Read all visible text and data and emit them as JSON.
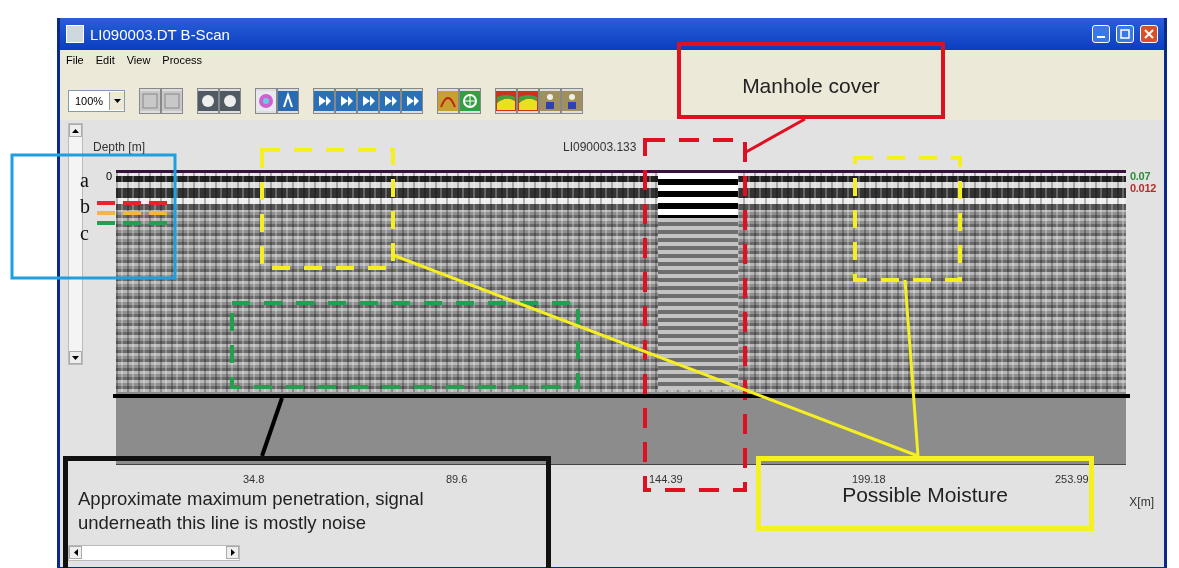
{
  "window": {
    "title": "LI090003.DT  B-Scan"
  },
  "menu": [
    "File",
    "Edit",
    "View",
    "Process"
  ],
  "toolbar": {
    "zoom": "100%"
  },
  "scan": {
    "depth_label": "Depth [m]",
    "depth_zero": "0",
    "file_label": "LI090003.133",
    "right_scale": [
      {
        "text": "0.07",
        "color": "#2e8b3e"
      },
      {
        "text": "0.012",
        "color": "#b03030"
      }
    ],
    "x_ticks": [
      "34.8",
      "89.6",
      "144.39",
      "199.18",
      "253.99"
    ],
    "x_unit": "X[m]"
  },
  "annotations": {
    "layer_labels": [
      "a",
      "b",
      "c"
    ],
    "layer_markers": [
      {
        "color": "#e8242a"
      },
      {
        "color": "#f0b840"
      },
      {
        "color": "#22a050"
      }
    ],
    "manhole_callout": "Manhole cover",
    "moisture_callout": "Possible Moisture",
    "penetration_callout": "Approximate maximum penetration, signal underneath this line is mostly noise"
  }
}
